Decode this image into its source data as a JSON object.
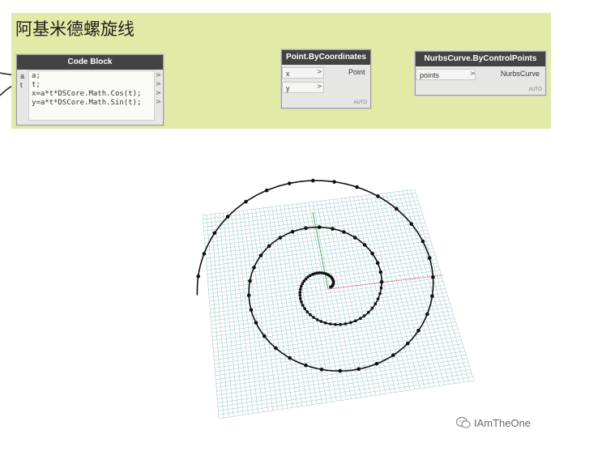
{
  "group": {
    "title": "阿基米德螺旋线"
  },
  "code_block": {
    "header": "Code Block",
    "inputs": [
      "a",
      "t"
    ],
    "lines": [
      "a;",
      "t;",
      "x=a*t*DSCore.Math.Cos(t);",
      "y=a*t*DSCore.Math.Sin(t);"
    ]
  },
  "point_node": {
    "header": "Point.ByCoordinates",
    "inputs": [
      "x",
      "y"
    ],
    "output": "Point",
    "lacing": "AUTO"
  },
  "nurbs_node": {
    "header": "NurbsCurve.ByControlPoints",
    "input": "points",
    "output": "NurbsCurve",
    "lacing": "AUTO"
  },
  "watermark": {
    "text": "IAmTheOne"
  },
  "colors": {
    "group_bg": "#e1eaa6",
    "node_header": "#434343",
    "wire": "#3d3d3d",
    "axis_x": "#e05050",
    "axis_y": "#3aa040",
    "grid": "#9fc5c8"
  },
  "spiral": {
    "equation": "r = a*t",
    "turns": 2.5
  }
}
